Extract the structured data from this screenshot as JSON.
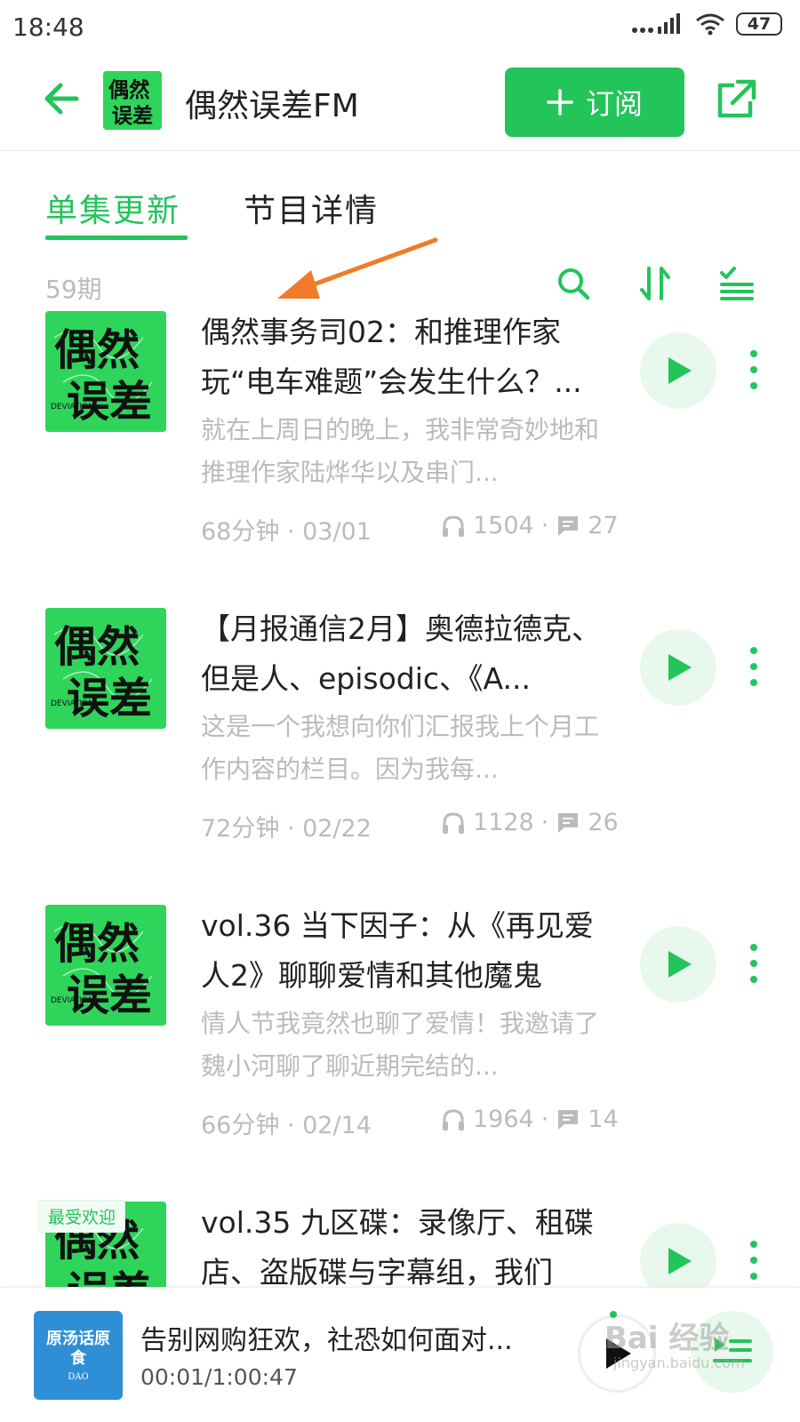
{
  "status_bar": {
    "time": "18:48",
    "battery": "47"
  },
  "header": {
    "title": "偶然误差FM",
    "subscribe_label": "订阅"
  },
  "tabs": [
    {
      "label": "单集更新"
    },
    {
      "label": "节目详情"
    }
  ],
  "toolbar": {
    "episode_count": "59期"
  },
  "cover": {
    "line1": "偶然",
    "line2": "误差",
    "small_text": "DEVIATION"
  },
  "episodes": [
    {
      "title": "偶然事务司02：和推理作家玩“电车难题”会发生什么？...",
      "desc": "就在上周日的晚上，我非常奇妙地和推理作家陆烨华以及串门...",
      "meta": "68分钟 · 03/01",
      "plays": "1504",
      "comments": "27"
    },
    {
      "title": "【月报通信2月】奥德拉德克、但是人、episodic、《A...",
      "desc": "这是一个我想向你们汇报我上个月工作内容的栏目。因为我每...",
      "meta": "72分钟 · 02/22",
      "plays": "1128",
      "comments": "26"
    },
    {
      "title": "vol.36 当下因子：从《再见爱人2》聊聊爱情和其他魔鬼",
      "desc": "情人节我竟然也聊了爱情！我邀请了魏小河聊了聊近期完结的...",
      "meta": "66分钟 · 02/14",
      "plays": "1964",
      "comments": "14"
    },
    {
      "badge": "最受欢迎",
      "title": "vol.35 九区碟：录像厅、租碟店、盗版碟与字幕组，我们",
      "desc": "",
      "meta": "",
      "plays": "",
      "comments": ""
    }
  ],
  "mini_player": {
    "title": "告别网购狂欢，社恐如何面对...",
    "time": "00:01/1:00:47",
    "cover_big": "原汤话原食",
    "cover_small": "DAO"
  },
  "watermark": {
    "text": "Bai 经验",
    "sub": "jingyan.baidu.com"
  },
  "colors": {
    "accent": "#23c45a",
    "cover_green": "#2ed55a",
    "muted": "#bbbbbb"
  }
}
